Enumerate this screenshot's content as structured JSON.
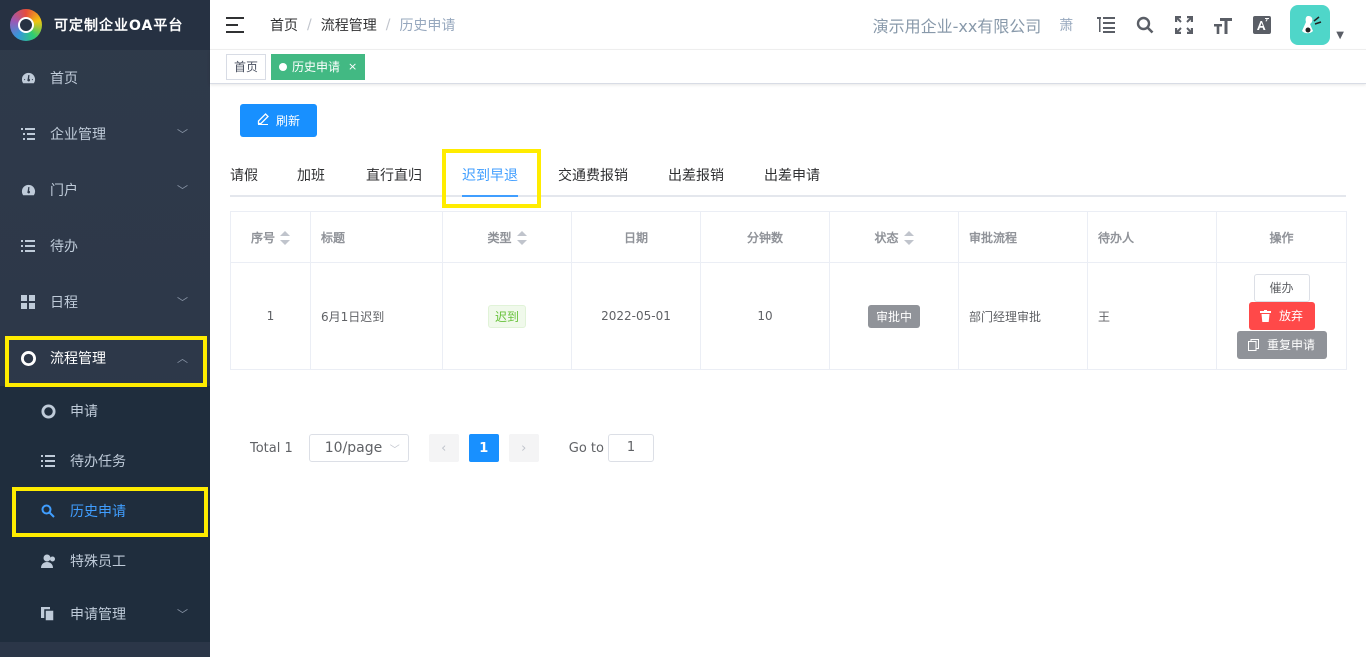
{
  "app": {
    "title": "可定制企业OA平台"
  },
  "sidebar": {
    "items": [
      {
        "label": "首页",
        "icon": "dashboard-icon",
        "expandable": false
      },
      {
        "label": "企业管理",
        "icon": "list-icon",
        "expandable": true
      },
      {
        "label": "门户",
        "icon": "dashboard-icon",
        "expandable": true
      },
      {
        "label": "待办",
        "icon": "list-icon",
        "expandable": false
      },
      {
        "label": "日程",
        "icon": "grid-icon",
        "expandable": true
      },
      {
        "label": "流程管理",
        "icon": "lifebuoy-icon",
        "expandable": true,
        "expanded": true
      }
    ],
    "subitems": [
      {
        "label": "申请",
        "icon": "lifebuoy-icon"
      },
      {
        "label": "待办任务",
        "icon": "list-icon"
      },
      {
        "label": "历史申请",
        "icon": "search-icon",
        "active": true
      },
      {
        "label": "特殊员工",
        "icon": "user-icon"
      },
      {
        "label": "申请管理",
        "icon": "copy-icon",
        "expandable": true
      }
    ]
  },
  "navbar": {
    "breadcrumb": [
      "首页",
      "流程管理",
      "历史申请"
    ],
    "company": "演示用企业-xx有限公司",
    "small_text": "萧"
  },
  "tags_view": {
    "tags": [
      {
        "label": "首页",
        "active": false
      },
      {
        "label": "历史申请",
        "active": true,
        "close": "×"
      }
    ]
  },
  "toolbar": {
    "refresh_label": "刷新"
  },
  "tabs": {
    "items": [
      "请假",
      "加班",
      "直行直归",
      "迟到早退",
      "交通费报销",
      "出差报销",
      "出差申请"
    ],
    "active_index": 3
  },
  "table": {
    "headers": [
      "序号",
      "标题",
      "类型",
      "日期",
      "分钟数",
      "状态",
      "审批流程",
      "待办人",
      "操作"
    ],
    "rows": [
      {
        "index": "1",
        "title": "6月1日迟到",
        "type": "迟到",
        "date": "2022-05-01",
        "minutes": "10",
        "status": "审批中",
        "flow": "部门经理审批",
        "assignee": "王",
        "actions": {
          "urge": "催办",
          "abandon": "放弃",
          "repeat": "重复申请"
        }
      }
    ]
  },
  "pagination": {
    "total": "Total 1",
    "page_size": "10/page",
    "current": "1",
    "goto_label": "Go to",
    "goto_value": "1"
  },
  "colors": {
    "sidebar_bg": "#2f3a4a",
    "primary": "#1890ff",
    "tag_active": "#42b983",
    "danger": "#ff4949",
    "highlight": "#ffec00"
  }
}
